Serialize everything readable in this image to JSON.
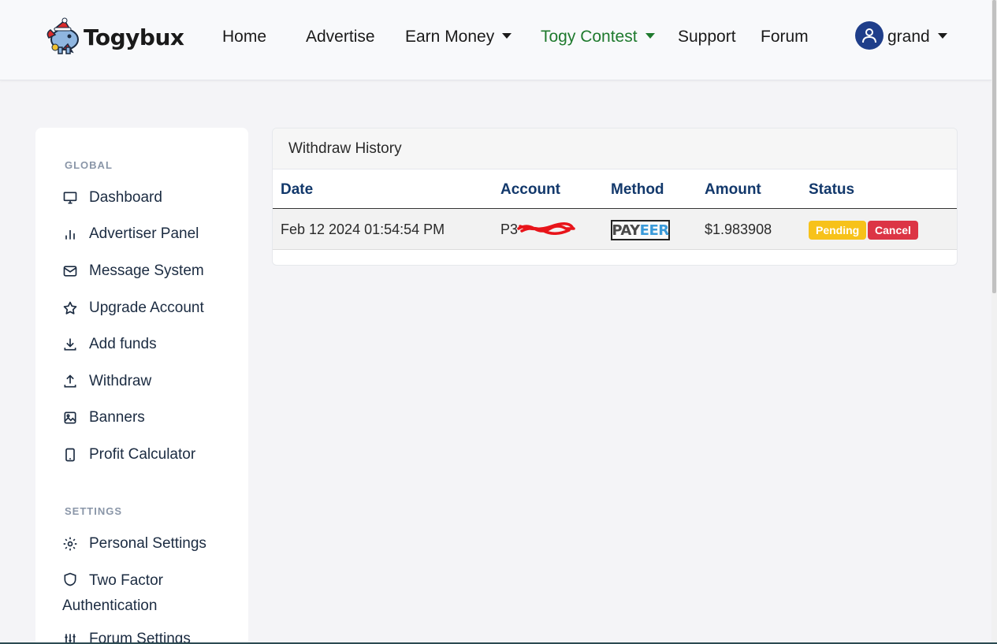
{
  "brand": {
    "name": "Togybux"
  },
  "nav": {
    "home": "Home",
    "advertise": "Advertise",
    "earn_money": "Earn Money",
    "togy_contest": "Togy Contest",
    "support": "Support",
    "forum": "Forum",
    "user": "grand"
  },
  "sidebar": {
    "global_title": "GLOBAL",
    "settings_title": "SETTINGS",
    "items": [
      {
        "label": "Dashboard",
        "icon": "monitor-icon"
      },
      {
        "label": "Advertiser Panel",
        "icon": "bar-chart-icon"
      },
      {
        "label": "Message System",
        "icon": "envelope-icon"
      },
      {
        "label": "Upgrade Account",
        "icon": "star-icon"
      },
      {
        "label": "Add funds",
        "icon": "download-icon"
      },
      {
        "label": "Withdraw",
        "icon": "upload-icon"
      },
      {
        "label": "Banners",
        "icon": "image-icon"
      },
      {
        "label": "Profit Calculator",
        "icon": "tablet-icon"
      }
    ],
    "settings_items": [
      {
        "label": "Personal Settings",
        "icon": "gear-icon"
      },
      {
        "label": "Two Factor Authentication",
        "icon": "shield-icon"
      },
      {
        "label": "Forum Settings",
        "icon": "sliders-icon"
      }
    ]
  },
  "withdraw": {
    "title": "Withdraw History",
    "columns": [
      "Date",
      "Account",
      "Method",
      "Amount",
      "Status"
    ],
    "rows": [
      {
        "date": "Feb 12 2024 01:54:54 PM",
        "account": "P3",
        "method": "PAYEER",
        "method_part1": "PAY",
        "method_part2": "EER",
        "amount": "$1.983908",
        "status": "Pending",
        "action": "Cancel"
      }
    ]
  },
  "colors": {
    "accent_green": "#1f7a2e",
    "header_blue": "#12386b",
    "pending": "#f7c21a",
    "cancel": "#dc3545"
  }
}
